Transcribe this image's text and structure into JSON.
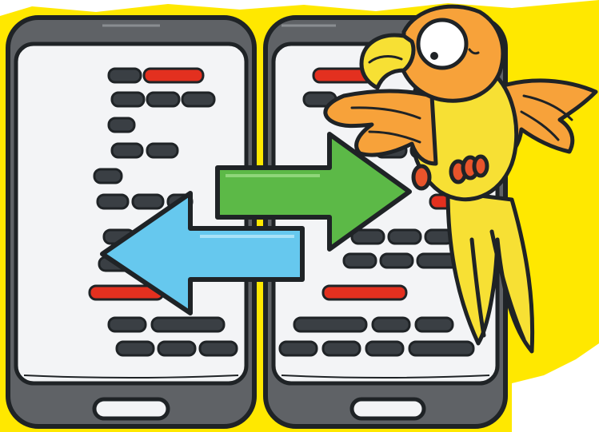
{
  "illustration": {
    "subject": "two-phones-code-exchange-with-parrot",
    "colors": {
      "background_splash": "#ffe800",
      "phone_body": "#5f6266",
      "phone_screen": "#f3f4f6",
      "outline": "#1f2326",
      "code_block_dark": "#3a3f44",
      "code_block_red": "#e3301f",
      "arrow_green": "#5cb947",
      "arrow_blue": "#66c8ee",
      "parrot_orange": "#f7a23a",
      "parrot_yellow": "#f7e034",
      "parrot_feet": "#e8542b"
    },
    "left_phone": {
      "code_lines": [
        [
          "dark",
          "red"
        ],
        [
          "dark",
          "dark",
          "dark"
        ],
        [
          "dark"
        ],
        [
          "dark",
          "dark"
        ],
        [
          "dark"
        ],
        [
          "dark",
          "dark",
          "dark"
        ],
        [
          "dark",
          "dark"
        ],
        [
          "dark",
          "dark",
          "dark"
        ],
        [
          "red"
        ],
        [
          "dark",
          "dark"
        ],
        [
          "dark",
          "dark",
          "dark"
        ]
      ]
    },
    "right_phone": {
      "code_lines": [
        [
          "red",
          "red"
        ],
        [
          "dark",
          "dark"
        ],
        [
          "dark",
          "dark"
        ],
        [
          "dark",
          "dark"
        ],
        [
          "dark",
          "red"
        ],
        [
          "dark",
          "dark",
          "dark"
        ],
        [
          "dark",
          "dark",
          "dark"
        ],
        [
          "red"
        ],
        [
          "dark",
          "dark",
          "dark"
        ],
        [
          "dark",
          "dark",
          "dark",
          "dark"
        ]
      ]
    },
    "arrows": [
      {
        "direction": "right",
        "color_key": "arrow_green"
      },
      {
        "direction": "left",
        "color_key": "arrow_blue"
      }
    ]
  }
}
